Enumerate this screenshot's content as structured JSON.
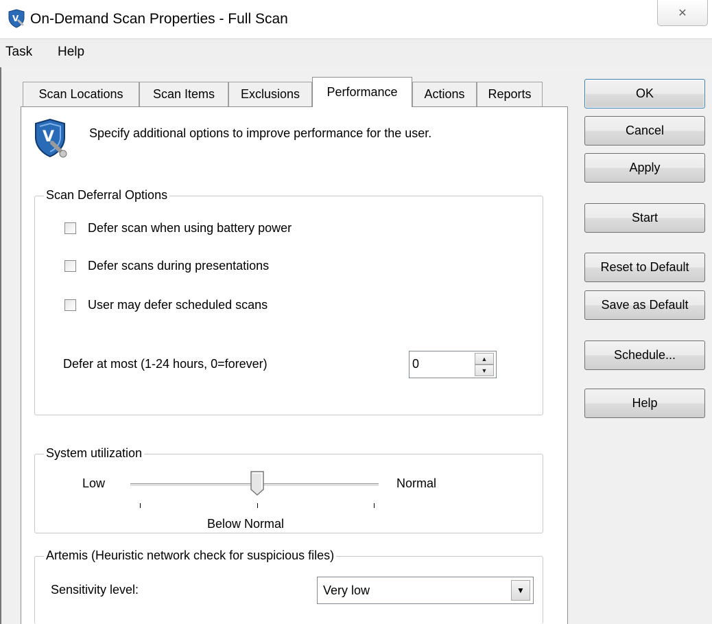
{
  "window": {
    "title": "On-Demand Scan Properties - Full Scan",
    "close_glyph": "✕"
  },
  "menu": [
    "Task",
    "Help"
  ],
  "tabs": [
    {
      "label": "Scan Locations"
    },
    {
      "label": "Scan Items"
    },
    {
      "label": "Exclusions"
    },
    {
      "label": "Performance",
      "active": true
    },
    {
      "label": "Actions"
    },
    {
      "label": "Reports"
    }
  ],
  "header": {
    "icon": "shield-wrench-icon",
    "description": "Specify additional options to improve performance for the user."
  },
  "scan_deferral": {
    "label": "Scan Deferral Options",
    "options": [
      {
        "label": "Defer scan when using battery power",
        "checked": false
      },
      {
        "label": "Defer scans during presentations",
        "checked": false
      },
      {
        "label": "User may defer scheduled scans",
        "checked": false
      }
    ],
    "defer_label": "Defer at most (1-24 hours, 0=forever)",
    "defer_value": "0"
  },
  "system_utilization": {
    "label": "System utilization",
    "low_label": "Low",
    "normal_label": "Normal",
    "current_label": "Below Normal",
    "level_index": 1,
    "level_count": 3
  },
  "artemis": {
    "label": "Artemis (Heuristic network check for suspicious files)",
    "sensitivity_label": "Sensitivity level:",
    "sensitivity_value": "Very low"
  },
  "buttons": {
    "ok": "OK",
    "cancel": "Cancel",
    "apply": "Apply",
    "start": "Start",
    "reset": "Reset to Default",
    "save": "Save as Default",
    "schedule": "Schedule...",
    "help": "Help"
  },
  "colors": {
    "accent": "#3c7fb1",
    "icon_blue": "#2a6bb8"
  }
}
